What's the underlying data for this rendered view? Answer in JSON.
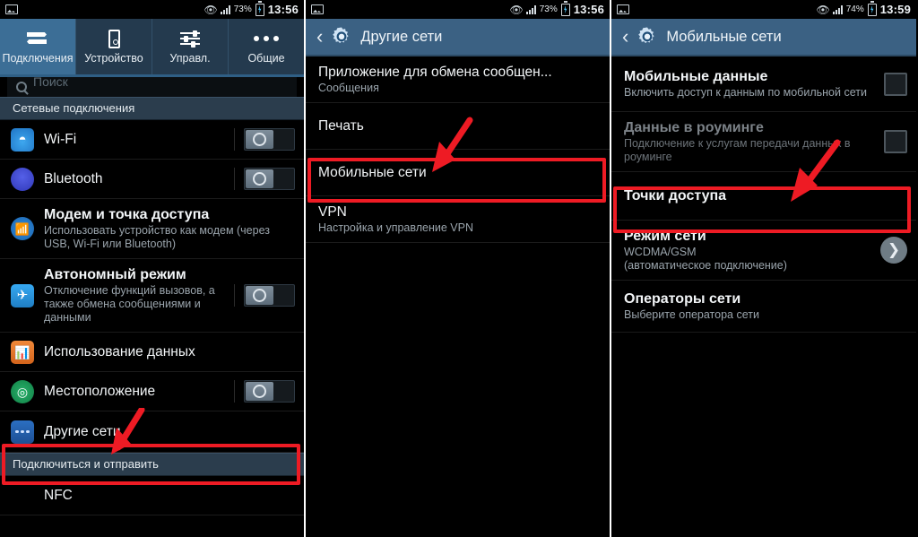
{
  "panels": [
    {
      "id": "connections",
      "status_bar": {
        "battery_pct": "73%",
        "time": "13:56"
      },
      "tabs": [
        {
          "label": "Подключения",
          "icon": "two-way-arrows-icon",
          "active": true
        },
        {
          "label": "Устройство",
          "icon": "phone-icon",
          "active": false
        },
        {
          "label": "Управл.",
          "icon": "sliders-icon",
          "active": false
        },
        {
          "label": "Общие",
          "icon": "three-dots-icon",
          "active": false
        }
      ],
      "search": {
        "placeholder": "Поиск"
      },
      "sections": [
        {
          "header": "Сетевые подключения",
          "rows": [
            {
              "title": "Wi-Fi",
              "sub": "",
              "icon": "wifi-icon",
              "control": "toggle",
              "toggle_state": "off"
            },
            {
              "title": "Bluetooth",
              "sub": "",
              "icon": "bluetooth-icon",
              "control": "toggle",
              "toggle_state": "off"
            },
            {
              "title": "Модем и точка доступа",
              "sub": "Использовать устройство как модем (через USB, Wi-Fi или Bluetooth)",
              "icon": "modem-hotspot-icon",
              "control": "none"
            },
            {
              "title": "Автономный режим",
              "sub": "Отключение функций вызовов, а также обмена сообщениями и данными",
              "icon": "airplane-icon",
              "control": "toggle",
              "toggle_state": "off"
            },
            {
              "title": "Использование данных",
              "sub": "",
              "icon": "data-usage-icon",
              "control": "none"
            },
            {
              "title": "Местоположение",
              "sub": "",
              "icon": "location-icon",
              "control": "toggle",
              "toggle_state": "off"
            },
            {
              "title": "Другие сети",
              "sub": "",
              "icon": "more-networks-icon",
              "control": "none",
              "highlighted": true
            }
          ]
        },
        {
          "header": "Подключиться и отправить",
          "rows": [
            {
              "title": "NFC",
              "sub": "",
              "icon": "none",
              "control": "none"
            }
          ]
        }
      ]
    },
    {
      "id": "other-networks",
      "status_bar": {
        "battery_pct": "73%",
        "time": "13:56"
      },
      "action_bar": {
        "title": "Другие сети",
        "back": "‹",
        "icon": "settings-gear-icon"
      },
      "rows": [
        {
          "title": "Приложение для обмена сообщен...",
          "sub": "Сообщения",
          "control": "none"
        },
        {
          "title": "Печать",
          "sub": "",
          "control": "none"
        },
        {
          "title": "Мобильные сети",
          "sub": "",
          "control": "none",
          "highlighted": true
        },
        {
          "title": "VPN",
          "sub": "Настройка и управление VPN",
          "control": "none"
        }
      ]
    },
    {
      "id": "mobile-networks",
      "status_bar": {
        "battery_pct": "74%",
        "time": "13:59"
      },
      "action_bar": {
        "title": "Мобильные сети",
        "back": "‹",
        "icon": "settings-gear-icon"
      },
      "rows": [
        {
          "title": "Мобильные данные",
          "sub": "Включить доступ к данным по мобильной сети",
          "control": "checkbox",
          "checked": false
        },
        {
          "title": "Данные в роуминге",
          "sub": "Подключение к услугам передачи данных в роуминге",
          "control": "checkbox",
          "checked": false,
          "dim": true
        },
        {
          "title": "Точки доступа",
          "sub": "",
          "control": "none",
          "highlighted": true
        },
        {
          "title": "Режим сети",
          "sub": "WCDMA/GSM\n(автоматическое подключение)",
          "control": "chevron"
        },
        {
          "title": "Операторы сети",
          "sub": "Выберите оператора сети",
          "control": "none"
        }
      ]
    }
  ],
  "annotations": {
    "highlight_color": "#ee1b24",
    "arrows": [
      {
        "panel": "connections",
        "points_to": "Другие сети"
      },
      {
        "panel": "other-networks",
        "points_to": "Мобильные сети"
      },
      {
        "panel": "mobile-networks",
        "points_to": "Точки доступа"
      }
    ]
  }
}
